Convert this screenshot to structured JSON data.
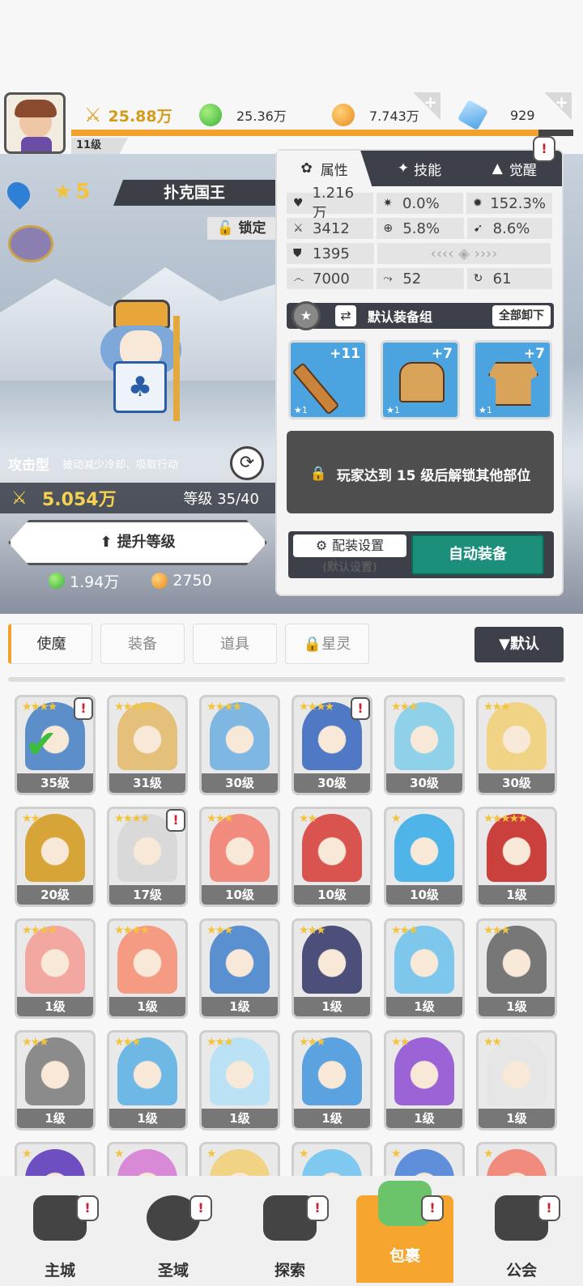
{
  "header": {
    "player_level": "11级",
    "power": "25.88万",
    "green_currency": "25.36万",
    "gold": "7.743万",
    "crystal": "929"
  },
  "hero": {
    "star": "5",
    "name": "扑克国王",
    "lock_label": "锁定",
    "type": "攻击型",
    "desc": "被动减少冷却、吸取行动",
    "power": "5.054万",
    "level": "等级 35/40",
    "upgrade": "提升等级",
    "cost_green": "1.94万",
    "cost_gold": "2750"
  },
  "panel": {
    "tabs": [
      "属性",
      "技能",
      "觉醒"
    ],
    "stats": [
      [
        "1.216万",
        "0.0%",
        "152.3%"
      ],
      [
        "3412",
        "5.8%",
        "8.6%"
      ],
      [
        "1395"
      ],
      [
        "7000",
        "52",
        "61"
      ]
    ],
    "equip_group": "默认装备组",
    "unequip_all": "全部卸下",
    "equip": [
      "+11",
      "+7",
      "+7"
    ],
    "equip_star": "★1",
    "locked_msg": "玩家达到 15 级后解锁其他部位",
    "config": "配装设置",
    "config_sub": "(默认设置)",
    "auto_equip": "自动装备"
  },
  "tabs": [
    "使魔",
    "装备",
    "道具",
    "星灵"
  ],
  "sort": "▼默认",
  "cards": [
    {
      "lv": "35级",
      "stars": "★★★★",
      "color": "#5c8fc9"
    },
    {
      "lv": "31级",
      "stars": "★★★★★",
      "color": "#e5c07b"
    },
    {
      "lv": "30级",
      "stars": "★★★★",
      "color": "#7fb7e3"
    },
    {
      "lv": "30级",
      "stars": "★★★★",
      "color": "#4f79c4"
    },
    {
      "lv": "30级",
      "stars": "★★★",
      "color": "#8fd1e8"
    },
    {
      "lv": "30级",
      "stars": "★★★",
      "color": "#f1d386"
    },
    {
      "lv": "20级",
      "stars": "★★",
      "color": "#d6a437"
    },
    {
      "lv": "17级",
      "stars": "★★★★",
      "color": "#d9d9d9"
    },
    {
      "lv": "10级",
      "stars": "★★★",
      "color": "#f08b7e"
    },
    {
      "lv": "10级",
      "stars": "★★",
      "color": "#d9534f"
    },
    {
      "lv": "10级",
      "stars": "★",
      "color": "#4fb5e8"
    },
    {
      "lv": "1级",
      "stars": "★★★★★",
      "color": "#c9403d"
    },
    {
      "lv": "1级",
      "stars": "★★★★",
      "color": "#f2a8a0"
    },
    {
      "lv": "1级",
      "stars": "★★★★",
      "color": "#f59b84"
    },
    {
      "lv": "1级",
      "stars": "★★★",
      "color": "#5a8fd0"
    },
    {
      "lv": "1级",
      "stars": "★★★",
      "color": "#4b4f7a"
    },
    {
      "lv": "1级",
      "stars": "★★★",
      "color": "#7ec7ec"
    },
    {
      "lv": "1级",
      "stars": "★★★",
      "color": "#777777"
    },
    {
      "lv": "1级",
      "stars": "★★★",
      "color": "#8b8b8b"
    },
    {
      "lv": "1级",
      "stars": "★★★",
      "color": "#6eb8e6"
    },
    {
      "lv": "1级",
      "stars": "★★★",
      "color": "#bbe1f5"
    },
    {
      "lv": "1级",
      "stars": "★★★",
      "color": "#5aa2e0"
    },
    {
      "lv": "1级",
      "stars": "★★",
      "color": "#9b63d6"
    },
    {
      "lv": "1级",
      "stars": "★★",
      "color": "#e6e6e6"
    },
    {
      "lv": "",
      "stars": "★",
      "color": "#6e4fc2"
    },
    {
      "lv": "",
      "stars": "★",
      "color": "#d98ad6"
    },
    {
      "lv": "",
      "stars": "★",
      "color": "#f1d386"
    },
    {
      "lv": "",
      "stars": "★",
      "color": "#7fc8ef"
    },
    {
      "lv": "",
      "stars": "★",
      "color": "#5f8fdb"
    },
    {
      "lv": "",
      "stars": "★",
      "color": "#f08b7e"
    }
  ],
  "nav": [
    "主城",
    "圣域",
    "探索",
    "包裹",
    "公会"
  ]
}
